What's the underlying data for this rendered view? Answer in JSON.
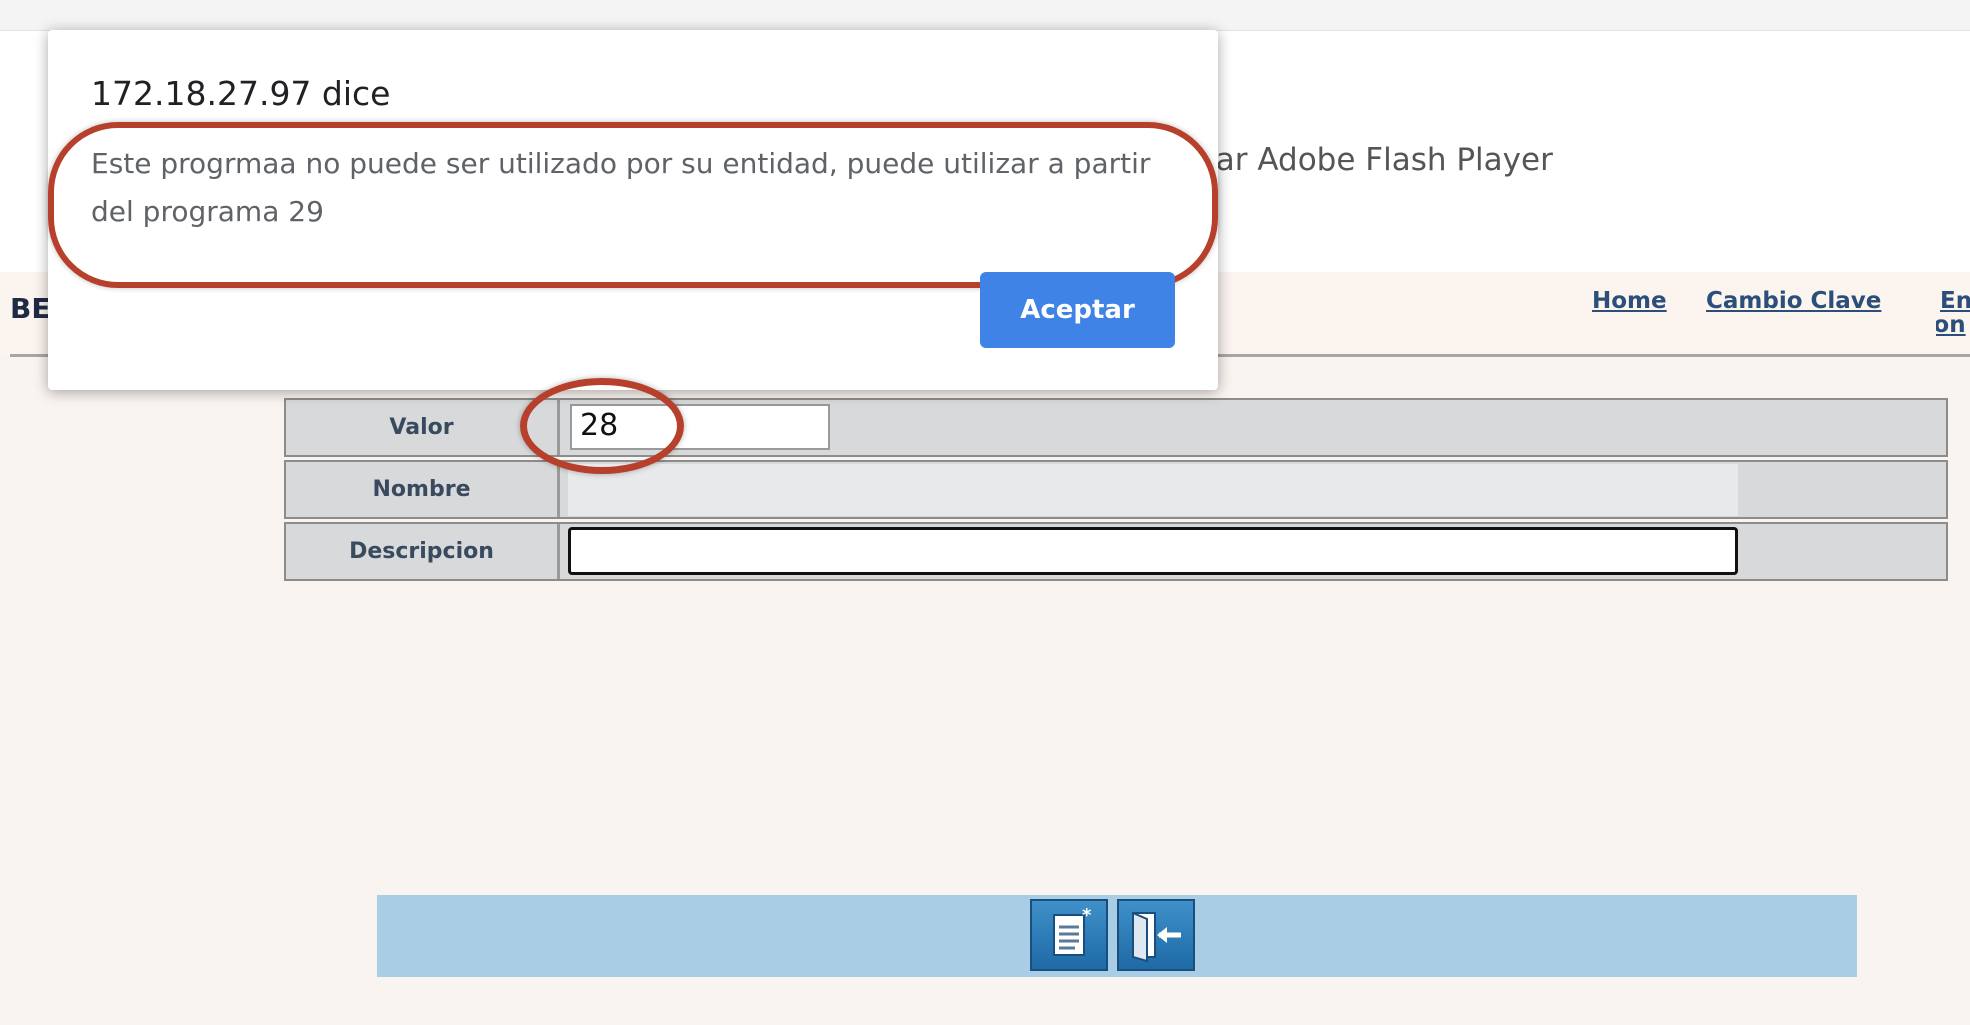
{
  "background_page": {
    "flash_message": "itar Adobe Flash Player",
    "bank_label": "BE",
    "nav": {
      "home": "Home",
      "cambio_clave": "Cambio Clave",
      "end_line1": "En",
      "end_line2": "(Con"
    }
  },
  "form": {
    "valor_label": "Valor",
    "valor_value": "28",
    "nombre_label": "Nombre",
    "descripcion_label": "Descripcion"
  },
  "toolbar": {
    "buttons": [
      {
        "icon": "new-document-icon"
      },
      {
        "icon": "exit-door-icon"
      }
    ]
  },
  "dialog": {
    "origin": "172.18.27.97 dice",
    "message": "Este progrmaa no puede ser utilizado por su entidad, puede utilizar a partir del programa 29",
    "accept_label": "Aceptar"
  },
  "colors": {
    "accept_button": "#3f83e6",
    "annotation_circle": "#b6402c",
    "toolbar_bg": "#aacde6",
    "page_bg": "#faf4f0"
  }
}
